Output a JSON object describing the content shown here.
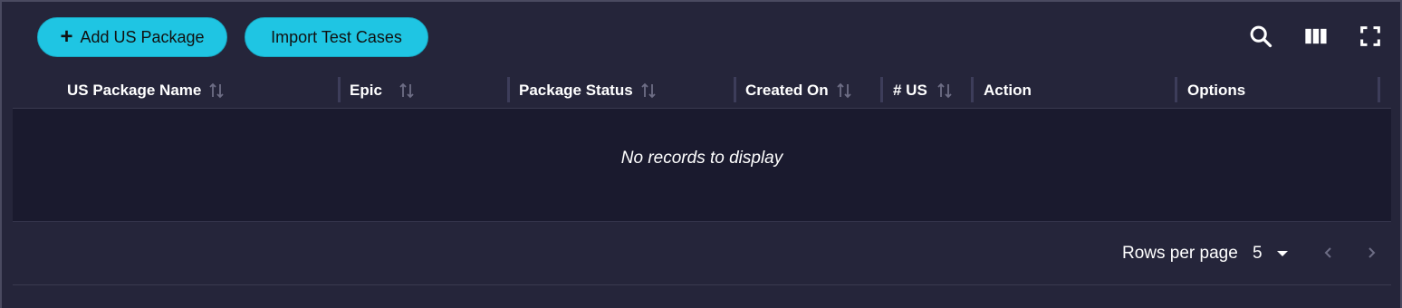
{
  "toolbar": {
    "add_label": "Add US Package",
    "import_label": "Import Test Cases",
    "icons": [
      "search-icon",
      "columns-icon",
      "fullscreen-icon"
    ]
  },
  "table": {
    "columns": [
      "US Package Name",
      "Epic",
      "Package Status",
      "Created On",
      "# US",
      "Action",
      "Options"
    ],
    "empty_message": "No records to display"
  },
  "pagination": {
    "rows_per_page_label": "Rows per page",
    "rows_per_page_value": "5"
  },
  "colors": {
    "accent": "#1fc5e3",
    "background": "#25253a",
    "table_body": "#1a1a2e"
  }
}
